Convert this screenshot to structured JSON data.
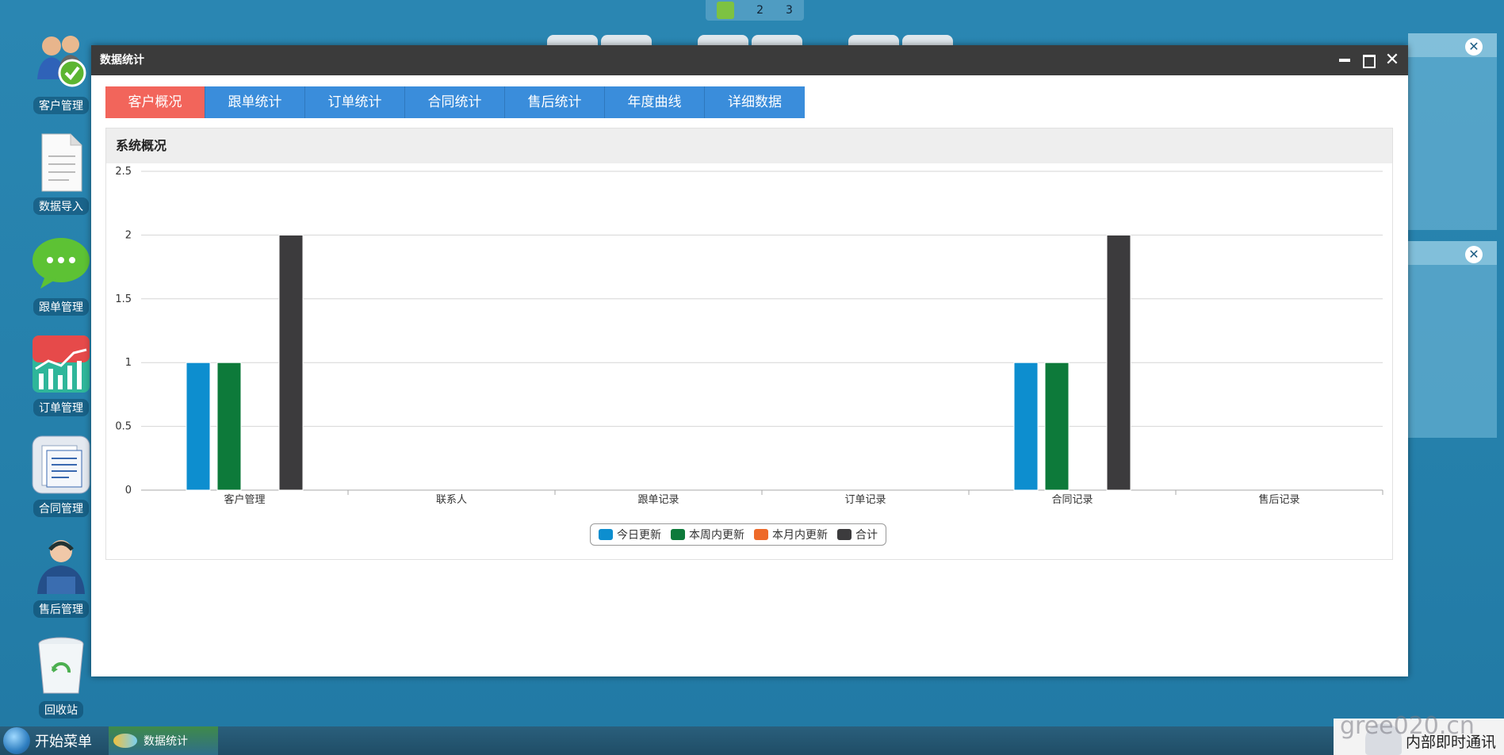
{
  "pager": {
    "pages": [
      "2",
      "3"
    ]
  },
  "desktop_icons": [
    {
      "label": "客户管理",
      "icon": "users-check-icon"
    },
    {
      "label": "数据导入",
      "icon": "document-icon"
    },
    {
      "label": "跟单管理",
      "icon": "chat-bubble-icon"
    },
    {
      "label": "订单管理",
      "icon": "trend-chart-icon"
    },
    {
      "label": "合同管理",
      "icon": "contract-doc-icon"
    },
    {
      "label": "售后管理",
      "icon": "support-agent-icon"
    },
    {
      "label": "回收站",
      "icon": "recycle-bin-icon"
    }
  ],
  "window": {
    "title": "数据统计",
    "tabs": [
      "客户概况",
      "跟单统计",
      "订单统计",
      "合同统计",
      "售后统计",
      "年度曲线",
      "详细数据"
    ],
    "active_tab": 0,
    "panel_title": "系统概况"
  },
  "chart_data": {
    "type": "bar",
    "title": "",
    "xlabel": "",
    "ylabel": "",
    "ylim": [
      0,
      2.5
    ],
    "yticks": [
      "0",
      "0.5",
      "1",
      "1.5",
      "2",
      "2.5"
    ],
    "categories": [
      "客户管理",
      "联系人",
      "跟单记录",
      "订单记录",
      "合同记录",
      "售后记录"
    ],
    "series": [
      {
        "name": "今日更新",
        "color": "#0d8ecf",
        "values": [
          1,
          0,
          0,
          0,
          1,
          0
        ]
      },
      {
        "name": "本周内更新",
        "color": "#0d7a3a",
        "values": [
          1,
          0,
          0,
          0,
          1,
          0
        ]
      },
      {
        "name": "本月内更新",
        "color": "#ee6a2a",
        "values": [
          0,
          0,
          0,
          0,
          0,
          0
        ]
      },
      {
        "name": "合计",
        "color": "#3c3b3d",
        "values": [
          2,
          0,
          0,
          0,
          2,
          0
        ]
      }
    ],
    "grid": true,
    "legend_position": "bottom-center"
  },
  "taskbar": {
    "start_label": "开始菜单",
    "task_label": "数据统计",
    "im_label": "内部即时通讯"
  },
  "watermark": "gree020.cn",
  "colors": {
    "accent_tab": "#f2655b",
    "tab": "#3a8ddb",
    "titlebar": "#3b3b3b"
  }
}
